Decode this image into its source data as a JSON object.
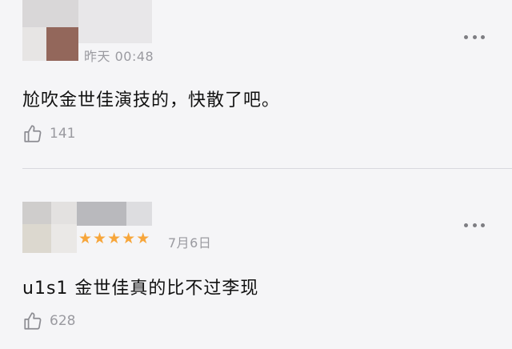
{
  "comments": [
    {
      "time": "昨天 00:48",
      "text": "尬吹金世佳演技的，快散了吧。",
      "likes": "141"
    },
    {
      "stars": [
        "★",
        "★",
        "★",
        "★",
        "★"
      ],
      "rating": 5,
      "date": "7月6日",
      "text": "u1s1 金世佳真的比不过李现",
      "likes": "628"
    }
  ],
  "colors": {
    "background": "#f5f5f7",
    "star": "#f7a63b",
    "meta": "#9a9aa0"
  },
  "icons": [
    "thumbs-up-icon",
    "more-icon"
  ]
}
